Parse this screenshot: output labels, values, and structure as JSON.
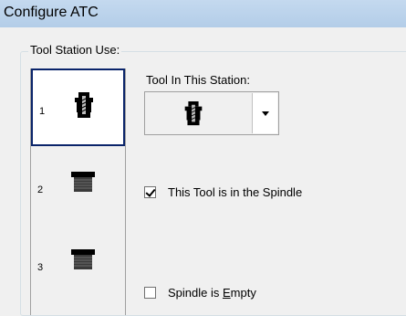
{
  "window": {
    "title": "Configure ATC"
  },
  "group": {
    "legend": "Tool Station Use:"
  },
  "stations": [
    {
      "number": "1",
      "icon": "tool-holder-with-tool-icon",
      "selected": true
    },
    {
      "number": "2",
      "icon": "empty-tool-holder-icon",
      "selected": false
    },
    {
      "number": "3",
      "icon": "empty-tool-holder-icon",
      "selected": false
    }
  ],
  "tool_in_station": {
    "label": "Tool In This Station:",
    "selected_icon": "tool-holder-with-tool-icon"
  },
  "spindle_checkbox": {
    "label": "This Tool is in the Spindle",
    "checked": true
  },
  "empty_checkbox": {
    "label_before": "Spindle is ",
    "label_accel": "E",
    "label_after": "mpty",
    "checked": false
  }
}
